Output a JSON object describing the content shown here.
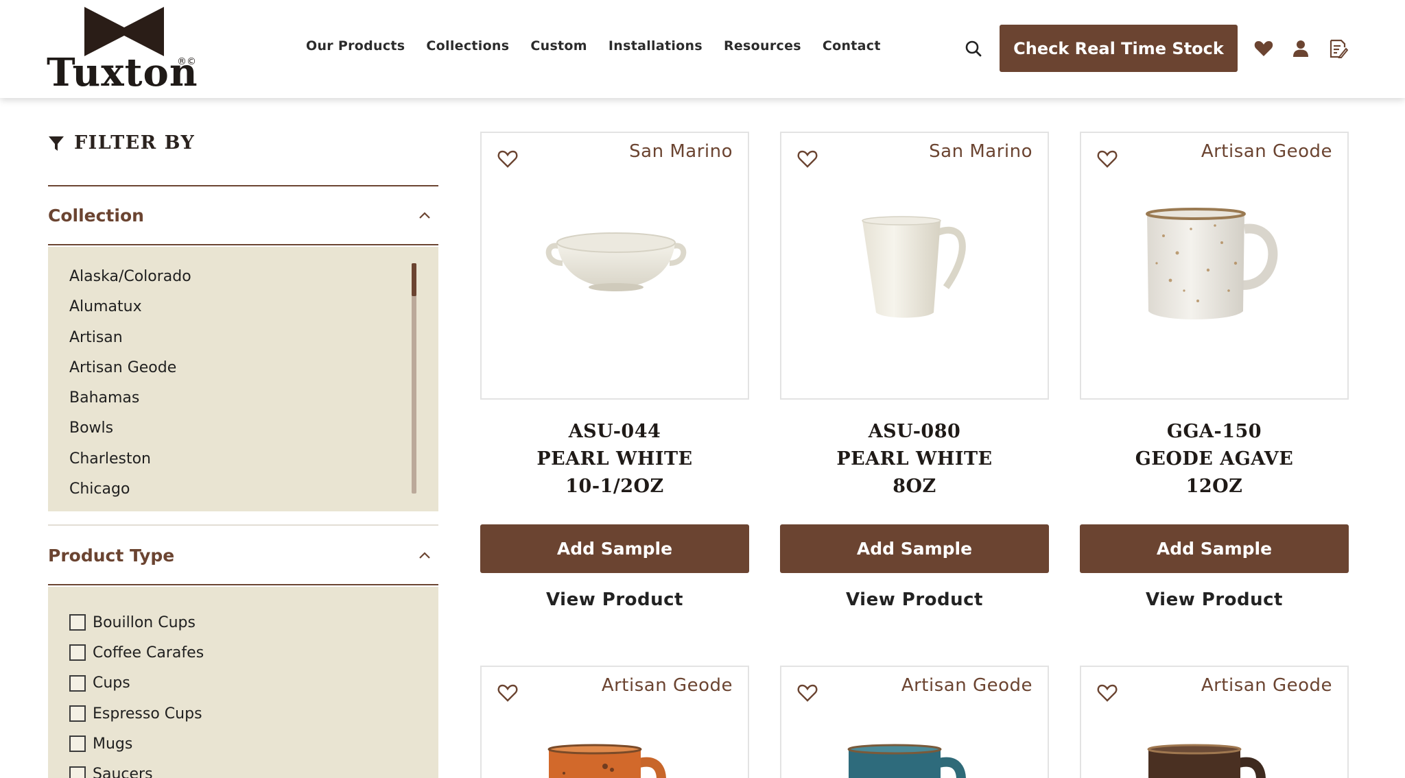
{
  "brand": {
    "name": "Tuxton",
    "mark": "®©"
  },
  "nav": {
    "items": [
      "Our Products",
      "Collections",
      "Custom",
      "Installations",
      "Resources",
      "Contact"
    ]
  },
  "header": {
    "stock_button": "Check Real Time Stock",
    "icons": [
      "search-icon",
      "heart-icon",
      "user-icon",
      "quote-list-icon"
    ]
  },
  "colors": {
    "brand_brown": "#6b4431",
    "facet_bg": "#e9e4d2"
  },
  "sidebar": {
    "title": "FILTER BY",
    "collection": {
      "label": "Collection",
      "items": [
        "Alaska/Colorado",
        "Alumatux",
        "Artisan",
        "Artisan Geode",
        "Bahamas",
        "Bowls",
        "Charleston",
        "Chicago"
      ]
    },
    "product_type": {
      "label": "Product Type",
      "items": [
        "Bouillon Cups",
        "Coffee Carafes",
        "Cups",
        "Espresso Cups",
        "Mugs",
        "Saucers"
      ]
    }
  },
  "products": [
    {
      "collection": "San Marino",
      "code": "ASU-044",
      "line2": "PEARL WHITE",
      "line3": "10-1/2OZ",
      "add_label": "Add Sample",
      "view_label": "View Product"
    },
    {
      "collection": "San Marino",
      "code": "ASU-080",
      "line2": "PEARL WHITE",
      "line3": "8OZ",
      "add_label": "Add Sample",
      "view_label": "View Product"
    },
    {
      "collection": "Artisan Geode",
      "code": "GGA-150",
      "line2": "GEODE AGAVE",
      "line3": "12OZ",
      "add_label": "Add Sample",
      "view_label": "View Product"
    },
    {
      "collection": "Artisan Geode"
    },
    {
      "collection": "Artisan Geode"
    },
    {
      "collection": "Artisan Geode"
    }
  ]
}
